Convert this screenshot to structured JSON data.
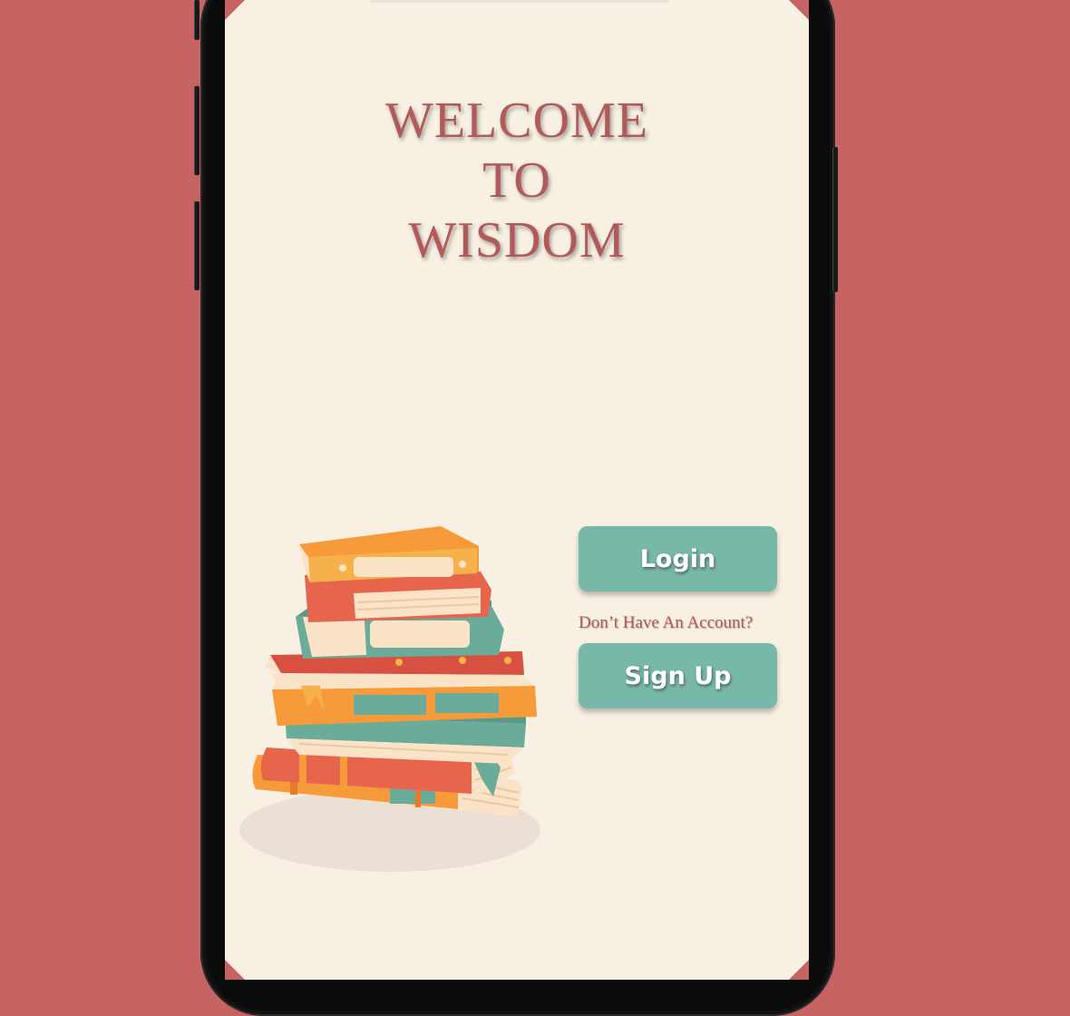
{
  "welcome": {
    "line1": "WELCOME",
    "line2": "TO",
    "line3": "WISDOM"
  },
  "auth": {
    "login_label": "Login",
    "account_prompt": "Don’t Have An Account?",
    "signup_label": "Sign Up"
  },
  "colors": {
    "background": "#c66363",
    "screen": "#f7f0e3",
    "accent": "#78b8a8",
    "title": "#b25a5a"
  },
  "illustration": "stack-of-books-illustration"
}
